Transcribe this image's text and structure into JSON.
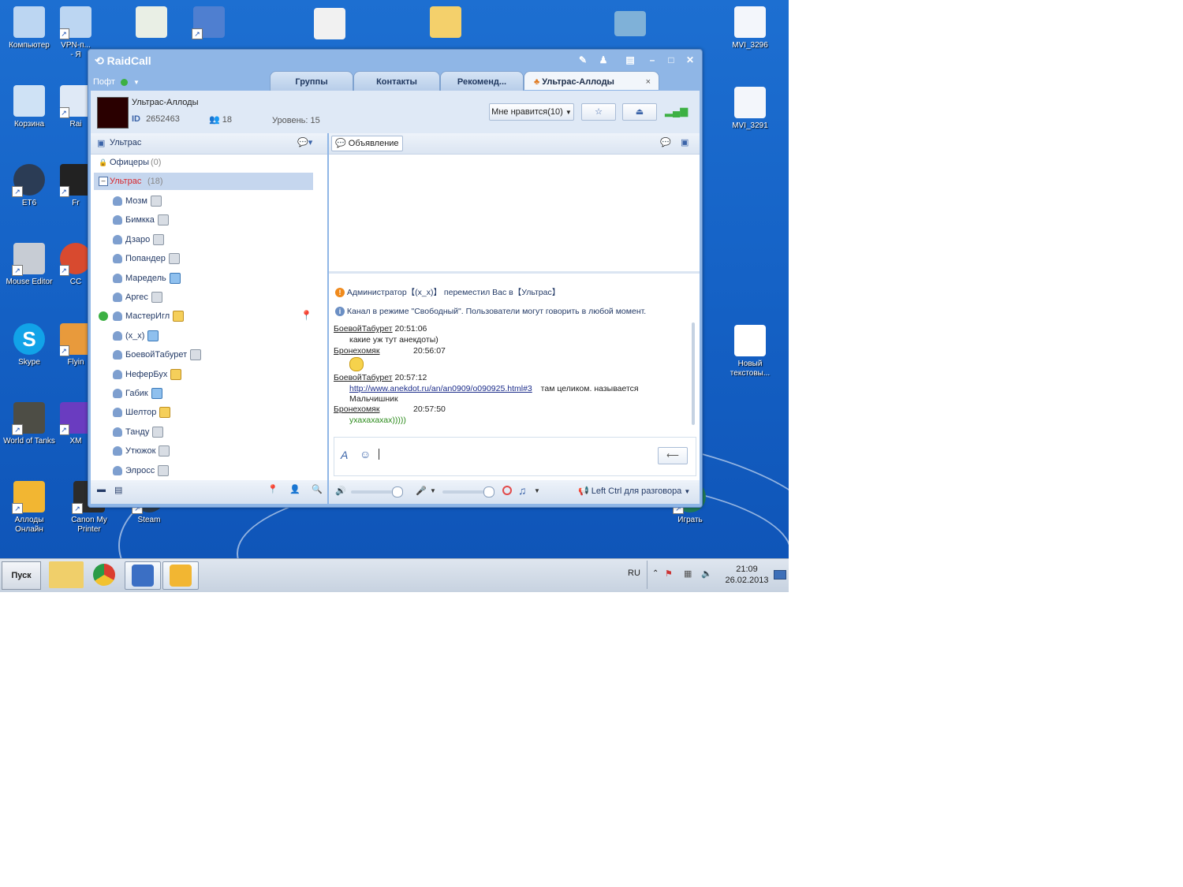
{
  "desktop": {
    "icons": [
      {
        "label": "Компьютер"
      },
      {
        "label": "VPN-п... - Я"
      },
      {
        "label": "Корзина"
      },
      {
        "label": "Rai"
      },
      {
        "label": "ET6"
      },
      {
        "label": "Fr"
      },
      {
        "label": "Mouse Editor"
      },
      {
        "label": "CC"
      },
      {
        "label": "Skype"
      },
      {
        "label": "Flyin"
      },
      {
        "label": "World of Tanks"
      },
      {
        "label": "XM"
      },
      {
        "label": "Аллоды Онлайн"
      },
      {
        "label": "Canon My Printer"
      },
      {
        "label": "Steam"
      },
      {
        "label": "Играть"
      },
      {
        "label": "MVI_3296"
      },
      {
        "label": "MVI_3291"
      },
      {
        "label": "Новый текстовы..."
      }
    ],
    "colors": {
      "wallpaper": "#1562c6",
      "accent": "#8fb6e6"
    }
  },
  "taskbar": {
    "start_label": "Пуск",
    "lang": "RU",
    "time": "21:09",
    "date": "26.02.2013"
  },
  "app": {
    "title": "RaidCall",
    "user": "Пофт",
    "tabs": [
      "Группы",
      "Контакты",
      "Рекоменд...",
      "Ультрас-Аллоды"
    ],
    "channel": {
      "name": "Ультрас-Аллоды",
      "id_label": "ID",
      "id": "2652463",
      "members": "18",
      "level": "Уровень: 15",
      "like_label": "Мне нравится(10)"
    },
    "left": {
      "room": "Ультрас",
      "groups": [
        {
          "name": "Офицеры",
          "count": "(0)"
        },
        {
          "name": "Ультрас",
          "count": "(18)"
        }
      ],
      "users": [
        {
          "name": "Мозм",
          "badge": "gray"
        },
        {
          "name": "Бимкка",
          "badge": "gray"
        },
        {
          "name": "Дзаро",
          "badge": "gray"
        },
        {
          "name": "Попандер",
          "badge": "gray"
        },
        {
          "name": "Маредель",
          "badge": "blue"
        },
        {
          "name": "Аргес",
          "badge": "gray"
        },
        {
          "name": "МастерИгл",
          "badge": "gold"
        },
        {
          "name": "(x_x)",
          "badge": "blue"
        },
        {
          "name": "БоевойТабурет",
          "badge": "gray"
        },
        {
          "name": "НеферБух",
          "badge": "gold"
        },
        {
          "name": "Габик",
          "badge": "blue"
        },
        {
          "name": "Шелтор",
          "badge": "gold"
        },
        {
          "name": "Танду",
          "badge": "gray"
        },
        {
          "name": "Утюжок",
          "badge": "gray"
        },
        {
          "name": "Элросс",
          "badge": "gray"
        }
      ]
    },
    "right": {
      "announce_label": "Объявление",
      "system_messages": [
        "Администратор【(x_x)】 переместил Вас в【Ультрас】",
        "Канал в режиме \"Свободный\". Пользователи могут говорить в любой момент."
      ],
      "chat": [
        {
          "user": "БоевойТабурет",
          "time": "20:51:06",
          "text": "какие уж тут анекдоты)"
        },
        {
          "user": "Бронехомяк",
          "time": "20:56:07",
          "text": ""
        },
        {
          "user": "БоевойТабурет",
          "time": "20:57:12",
          "link": "http://www.anekdot.ru/an/an0909/o090925.html#3",
          "text": "там целиком. называется",
          "text2": "Мальчишник"
        },
        {
          "user": "Бронехомяк",
          "time": "20:57:50",
          "text": "ухахахахах)))))"
        }
      ],
      "ptt_label": "Left Ctrl для разговора"
    }
  }
}
